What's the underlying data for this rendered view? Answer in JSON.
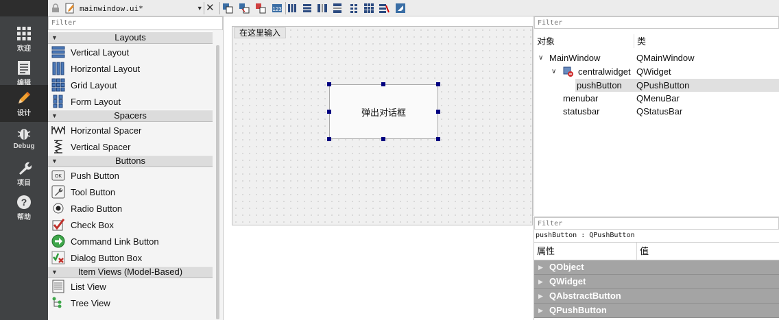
{
  "toolbar": {
    "document_name": "mainwindow.ui*"
  },
  "modes": [
    {
      "label": "欢迎",
      "icon": "grid-icon"
    },
    {
      "label": "编辑",
      "icon": "document-icon"
    },
    {
      "label": "设计",
      "icon": "pencil-icon"
    },
    {
      "label": "Debug",
      "icon": "bug-icon"
    },
    {
      "label": "项目",
      "icon": "wrench-icon"
    },
    {
      "label": "帮助",
      "icon": "help-icon"
    }
  ],
  "widget_box": {
    "filter_placeholder": "Filter",
    "categories": [
      {
        "name": "Layouts",
        "items": [
          "Vertical Layout",
          "Horizontal Layout",
          "Grid Layout",
          "Form Layout"
        ]
      },
      {
        "name": "Spacers",
        "items": [
          "Horizontal Spacer",
          "Vertical Spacer"
        ]
      },
      {
        "name": "Buttons",
        "items": [
          "Push Button",
          "Tool Button",
          "Radio Button",
          "Check Box",
          "Command Link Button",
          "Dialog Button Box"
        ]
      },
      {
        "name": "Item Views (Model-Based)",
        "items": [
          "List View",
          "Tree View"
        ]
      }
    ]
  },
  "form": {
    "menu_placeholder": "在这里输入",
    "push_button_text": "弹出对话框"
  },
  "object_inspector": {
    "filter_placeholder": "Filter",
    "col_object": "对象",
    "col_class": "类",
    "rows": [
      {
        "name": "MainWindow",
        "class": "QMainWindow"
      },
      {
        "name": "centralwidget",
        "class": "QWidget"
      },
      {
        "name": "pushButton",
        "class": "QPushButton"
      },
      {
        "name": "menubar",
        "class": "QMenuBar"
      },
      {
        "name": "statusbar",
        "class": "QStatusBar"
      }
    ]
  },
  "property_editor": {
    "filter_placeholder": "Filter",
    "title": "pushButton : QPushButton",
    "col_property": "属性",
    "col_value": "值",
    "groups": [
      "QObject",
      "QWidget",
      "QAbstractButton",
      "QPushButton"
    ]
  },
  "colors": {
    "modebar": "#404244",
    "selection_handle": "#000080",
    "property_group": "#a4a4a4"
  }
}
